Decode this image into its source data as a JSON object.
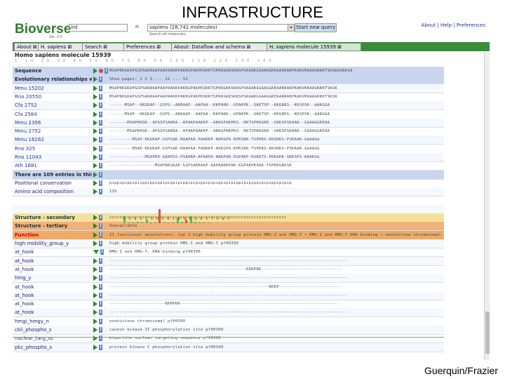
{
  "slide": {
    "title": "INFRASTRUCTURE",
    "credit": "Guerquin/Frazier"
  },
  "app": {
    "name": "Bioverse",
    "version": "Ver. 0.0",
    "query_field_1": "ird",
    "query_n": "n",
    "query_field_2": "sapiens (28,741 molecules)",
    "query_dropdown": "▾",
    "new_query_button": "Start new query",
    "query_sub": "Search all molecules",
    "top_links": "About | Help | Preferences"
  },
  "tabs": [
    {
      "label": "About ⊠"
    },
    {
      "label": "H. sapiens ⊠"
    },
    {
      "label": "Search ⊠"
    },
    {
      "label": "Preferences ⊠"
    },
    {
      "label": "About: Dataflow and schema ⊠"
    },
    {
      "label": "H. sapiens molecule 15939 ⊠"
    }
  ],
  "page_title": "Homo sapiens molecule 15939",
  "ruler": "1 10 20 30 40 50 60 70 80 90 100 110 120 130 140",
  "rows": [
    {
      "label": "Sequence",
      "data": "MSAPKKGKAPGSPSAKRAAPAAPAAKKPAKKGPAKPKSKKTSPKKGKKSKKSPSKAAKGGAAGGKEAAKRAKPKAKVKKAAGKKKTSKSKASKKSA",
      "style": "band-blue"
    },
    {
      "label": "Evolutionary relationships with 114 molecules",
      "data": "Show pages: 1 2 3 ... 11 ... 12",
      "style": "band-blue"
    },
    {
      "label": "Mmu 15202",
      "data": "MSAPKKGKAPGSPSAKRAAPAAPAAKKPAKKGPAKPKSKKTSPKKGKKSKKSPSKAAKGGAAGGKEAAKRAKPKAKVKKAAGKKKTSKSK",
      "style": "link"
    },
    {
      "label": "Rno 20550",
      "data": "MSAPKKGKAPGSPSAKRAAPAAPAAKKPAKKGPAKPKSKKTSPKKGKKSKKSPSKAAKGGAAGGKEAAKRAKPKAKVKKAAGKKKTSKSK",
      "style": "link"
    },
    {
      "label": "Cfa 2752",
      "data": "------MSAP--KKGKAP--GSPS--AKRAAP--AAPAA--KKPAKK--GPAKPK--SKKTSP--KKGKKS--KKSPSK--AAKGGA",
      "style": "link"
    },
    {
      "label": "Cfa 2584",
      "data": "------MSAP--KKGKAP--GSPS--AKRAAP--AAPAA--KKPAKK--GPAKPK--SKKTSP--KKGKKS--KKSPSK--AAKGGA",
      "style": "link"
    },
    {
      "label": "Mmu 2356",
      "data": "-------MSAPKKGK--APGSPSAKRA--APAAPAAKKP--AKKGPAKPKS--KKTSPKKGKK--SKKSPSKAAK--GGAAGGKEAA",
      "style": "link"
    },
    {
      "label": "Mmu 2752",
      "data": "-------MSAPKKGK--APGSPSAKRA--APAAPAAKKP--AKKGPAKPKS--KKTSPKKGKK--SKKSPSKAAK--GGAAGGKEAA",
      "style": "link"
    },
    {
      "label": "Mmu 16262",
      "data": "---------MSAP-KKGKAP-GSPSAK-RAAPAA-PAAKKP-AKKGPA-KPKSKK-TSPKKG-KKSKKS-PSKAAK-GGAAGG",
      "style": "link"
    },
    {
      "label": "Rno 325",
      "data": "---------MSAP-KKGKAP-GSPSAK-RAAPAA-PAAKKP-AKKGPA-KPKSKK-TSPKKG-KKSKKS-PSKAAK-GGAAGG",
      "style": "link"
    },
    {
      "label": "Rno 11043",
      "data": "--------------MSAPKK-GKAPGS-PSAKRA-APAAPA-AKKPAK-KGPAKP-KSKKTS-PKKGKK-SKKSPS-KAAKGG",
      "style": "link"
    },
    {
      "label": "Ath 1881",
      "data": "------------------MSAPKKGKAP-GSPSAKRAAP-AAPAAKKPAK-KGPAKPKSKK-TSPKKGKKSK",
      "style": "link"
    },
    {
      "label": "There are 109 entries in this molecule",
      "data": "",
      "style": "band-blue"
    },
    {
      "label": "Positional conservation",
      "data": "pippipippipiippippippipippipippipipippipipippipipippipipippipipippipipip",
      "style": "plain"
    },
    {
      "label": "Amino acid composition",
      "data": "12%",
      "style": "plain"
    },
    {
      "label": "",
      "data": "",
      "style": "plain"
    },
    {
      "label": "",
      "data": "",
      "style": "plain"
    },
    {
      "label": "Structure - secondary",
      "data": "cccccccccccccccccccccccccccccccccccccccccccccccccccccccccccccccccccccc",
      "style": "band-yellow"
    },
    {
      "label": "Structure - tertiary",
      "data": "Unavailable",
      "style": "band-orange"
    },
    {
      "label": "Function",
      "data": "11 functional annotations: top 2 high mobility group protein HMG-I and HMG-Y • HMG-I and HMG-Y DNA-binding • nonhistone chromosomal",
      "style": "band-func"
    },
    {
      "label": "high mobility_group_y",
      "data": "high mobility group protein HMG-I and HMG-Y   pf00390",
      "style": "plain"
    },
    {
      "label": "at_hook",
      "data": "HMG-I and HMG-Y, DNA-binding   pf00390",
      "style": "plain"
    },
    {
      "label": "at_hook",
      "data": "----------------------------------------------------------------------------------------------",
      "style": "plain"
    },
    {
      "label": "at_hook",
      "data": "------------------------------------------------------KKRPRK--------------------------------",
      "style": "plain"
    },
    {
      "label": "hmg_y",
      "data": "----------------------------------------------------------------------------------------------",
      "style": "plain"
    },
    {
      "label": "at_hook",
      "data": "---------------------------------------------------------------RKKP-------------------------",
      "style": "plain"
    },
    {
      "label": "at_hook",
      "data": "----------------------------------------------------------------------------------------------",
      "style": "plain"
    },
    {
      "label": "at_hook",
      "data": "----------------------KKRPRK--------------------------------------------------------------",
      "style": "plain"
    },
    {
      "label": "at_hook",
      "data": "----------------------------------------------------------------------------------------------",
      "style": "plain"
    },
    {
      "label": "hmgi_hmgy_n",
      "data": "nonhistone chromosomal   pf00390",
      "style": "plain"
    },
    {
      "label": "ckii_phospho_s",
      "data": "casein kinase II phosphorylation site   pf00390",
      "style": "plain"
    },
    {
      "label": "nuclear_targ_ss",
      "data": "bipartite nuclear targeting sequence   pf00390",
      "style": "plain"
    },
    {
      "label": "pkc_phospho_s",
      "data": "protein kinase C phosphorylation site   pf00390",
      "style": "plain"
    }
  ],
  "composition_letters": "A C D E F G H I K L M N P Q R S T V W Y",
  "composition_values": [
    12,
    0,
    1,
    3,
    0,
    6,
    1,
    1,
    24,
    1,
    0,
    1,
    10,
    2,
    6,
    12,
    3,
    1,
    0,
    1
  ],
  "composition_colors": [
    "#5cb85c",
    "#5cb85c",
    "#5cb85c",
    "#5cb85c",
    "#5cb85c",
    "#5cb85c",
    "#5cb85c",
    "#5cb85c",
    "#d9534f",
    "#5cb85c",
    "#5cb85c",
    "#5cb85c",
    "#5cb85c",
    "#5cb85c",
    "#d9534f",
    "#5cb85c",
    "#5cb85c",
    "#5cb85c",
    "#5cb85c",
    "#5cb85c"
  ]
}
